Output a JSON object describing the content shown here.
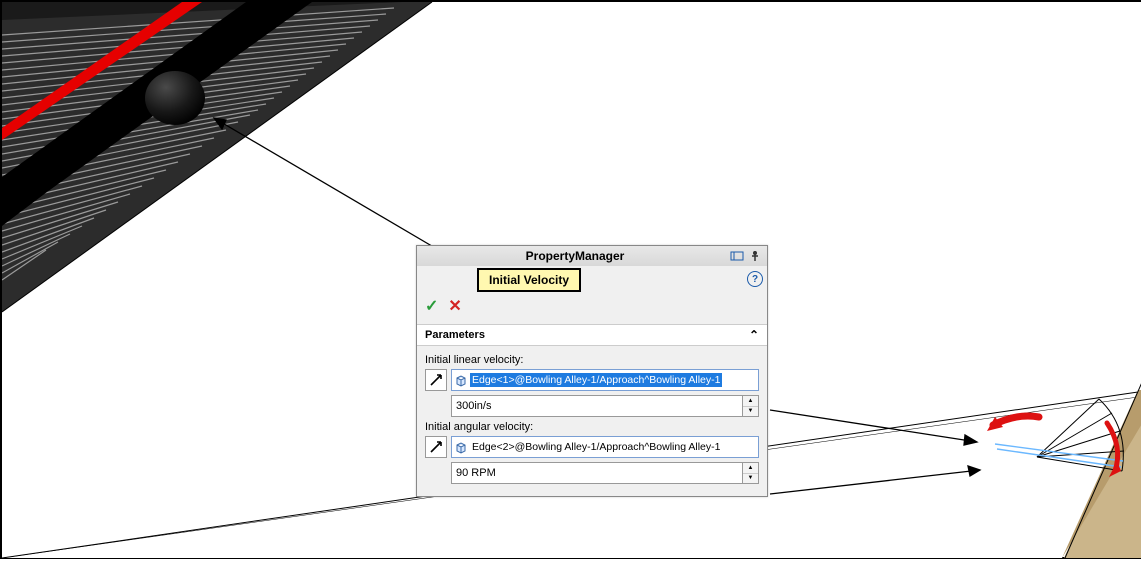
{
  "panel": {
    "title": "PropertyManager",
    "feature_tag": "Initial Velocity",
    "section": "Parameters",
    "linear": {
      "label": "Initial linear velocity:",
      "selection": "Edge<1>@Bowling Alley-1/Approach^Bowling Alley-1",
      "value": "300in/s"
    },
    "angular": {
      "label": "Initial angular velocity:",
      "selection": "Edge<2>@Bowling Alley-1/Approach^Bowling Alley-1",
      "value": "90 RPM"
    }
  }
}
